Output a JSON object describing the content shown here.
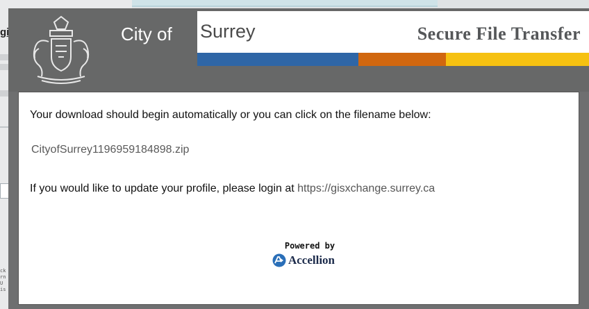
{
  "background": {
    "title_fragment": "gi",
    "tiny_text": "ck rn U is"
  },
  "header": {
    "city_of": "City of",
    "surrey": "Surrey",
    "title": "Secure File Transfer",
    "stripe_colors": [
      "#2f66a6",
      "#d1670f",
      "#f6c111"
    ],
    "crest_icon": "city-crest-icon"
  },
  "content": {
    "download_message": "Your download should begin automatically or you can click on the filename below:",
    "filename": "CityofSurrey1196959184898.zip",
    "profile_message": "If you would like to update your profile, please login at",
    "profile_url": "https://gisxchange.surrey.ca"
  },
  "footer": {
    "powered_by": "Powered by",
    "brand": "Accellion"
  }
}
